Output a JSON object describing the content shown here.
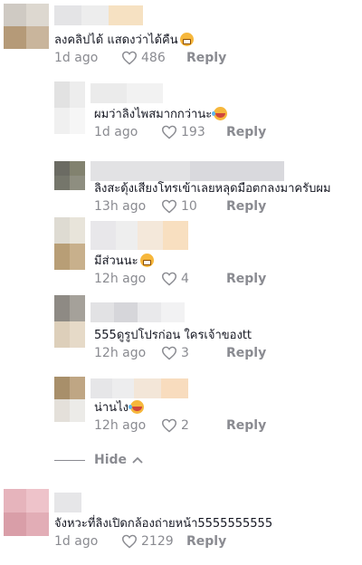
{
  "comments": [
    {
      "text": "ลงคลิปได้ แสดงว่าได้คืน",
      "emoji": "grin",
      "age": "1d ago",
      "likes": "486",
      "reply": "Reply"
    },
    {
      "text": "ผมว่าลิงไพสมากกว่านะ",
      "emoji": "laugh",
      "age": "1d ago",
      "likes": "193",
      "reply": "Reply"
    },
    {
      "text": "ลิงสะดุ้งเสียงโทรเข้าเลยหลุดมือตกลงมาครับผม",
      "emoji": "",
      "age": "13h ago",
      "likes": "10",
      "reply": "Reply"
    },
    {
      "text": "มีส่วนนะ",
      "emoji": "grin",
      "age": "12h ago",
      "likes": "4",
      "reply": "Reply"
    },
    {
      "text": "555ดูรูปโปรก่อน ใครเจ้าของtt",
      "emoji": "",
      "age": "12h ago",
      "likes": "3",
      "reply": "Reply"
    },
    {
      "text": "น่านไง",
      "emoji": "laugh",
      "age": "12h ago",
      "likes": "2",
      "reply": "Reply"
    },
    {
      "text": "จังหวะที่ลิงเปิดกล้องถ่ายหน้า5555555555",
      "emoji": "",
      "age": "1d ago",
      "likes": "2129",
      "reply": "Reply"
    }
  ],
  "hide": {
    "label": "Hide"
  },
  "colors": {
    "meta": "#8a8b91",
    "text": "#161823",
    "heart": "#8a8b91"
  }
}
